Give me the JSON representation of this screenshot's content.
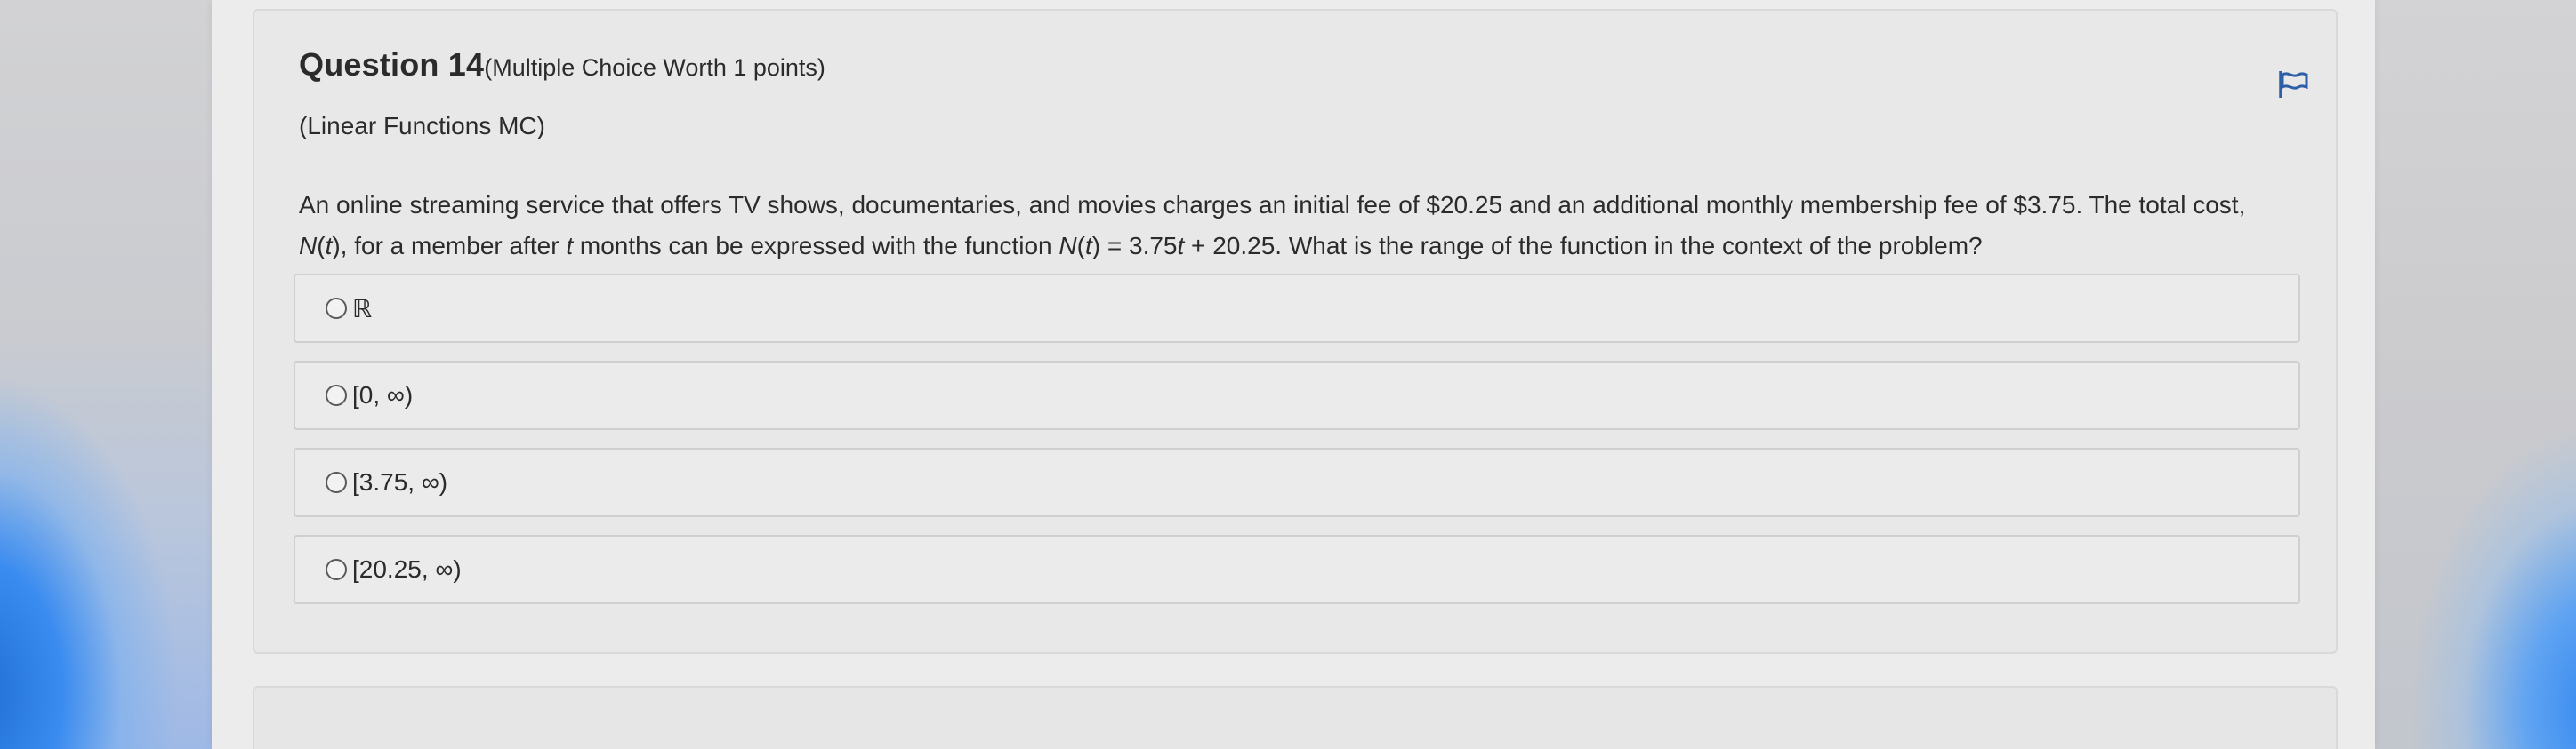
{
  "question": {
    "title": "Question 14",
    "points": "(Multiple Choice Worth 1 points)",
    "topic": "(Linear Functions MC)",
    "body_line1": "An online streaming service that offers TV shows, documentaries, and movies charges an initial fee of $20.25 and an additional monthly membership fee of $3.75. The total cost,",
    "body_line2_parts": {
      "n1": "N",
      "p1": "(",
      "t1": "t",
      "p2": "), for a member after ",
      "t2": "t",
      "p3": " months can be expressed with the function ",
      "n2": "N",
      "p4": "(",
      "t3": "t",
      "p5": ") = 3.75",
      "t4": "t",
      "p6": " + 20.25. What is the range of the function in the context of the problem?"
    }
  },
  "options": [
    {
      "label": "ℝ"
    },
    {
      "label": "[0, ∞)"
    },
    {
      "label": "[3.75, ∞)"
    },
    {
      "label": "[20.25, ∞)"
    }
  ],
  "icons": {
    "flag": "flag-icon",
    "radio": "radio-unselected-icon"
  },
  "colors": {
    "text": "#2b2b2b",
    "card_bg": "#e8e8e8",
    "option_border": "#cfcfcf",
    "desktop_accent": "#2f86f0"
  }
}
